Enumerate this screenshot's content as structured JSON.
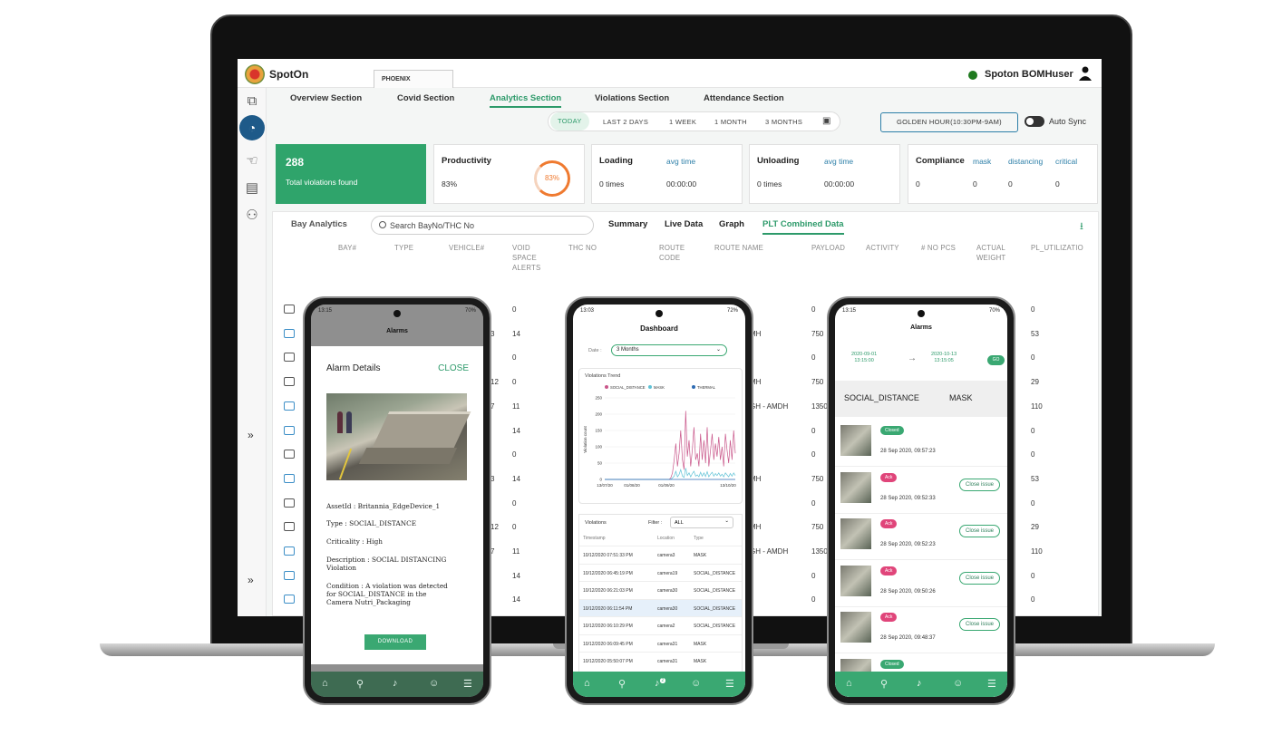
{
  "app": {
    "title": "SpotOn",
    "workspace_tab": "PHOENIX",
    "user": "Spoton BOMHuser",
    "status_color": "#1f7a1f",
    "accent": "#2d9a6a"
  },
  "rail": {
    "icons": [
      "hierarchy-icon",
      "dashboard-gauge-icon",
      "hand-icon",
      "building-icon",
      "group-icon"
    ],
    "expand_glyph": "»"
  },
  "sections": [
    "Overview Section",
    "Covid Section",
    "Analytics Section",
    "Violations Section",
    "Attendance Section"
  ],
  "active_section": "Analytics Section",
  "ranges": [
    "TODAY",
    "LAST 2 DAYS",
    "1 WEEK",
    "1 MONTH",
    "3 MONTHS"
  ],
  "active_range": "TODAY",
  "golden_hour": "GOLDEN HOUR(10:30PM-9AM)",
  "auto_sync": "Auto Sync",
  "kpi": {
    "violations": {
      "count": "288",
      "label": "Total violations found"
    },
    "productivity": {
      "title": "Productivity",
      "value": "83%",
      "ring": "83%"
    },
    "loading": {
      "title": "Loading",
      "avg_label": "avg time",
      "times": "0 times",
      "avg": "00:00:00"
    },
    "unloading": {
      "title": "Unloading",
      "avg_label": "avg time",
      "times": "0 times",
      "avg": "00:00:00"
    },
    "compliance": {
      "title": "Compliance",
      "labels": [
        "mask",
        "distancing",
        "critical"
      ],
      "values": [
        "0",
        "0",
        "0",
        "0"
      ]
    }
  },
  "bay": {
    "title": "Bay Analytics",
    "search_placeholder": "Search BayNo/THC No",
    "tabs": [
      "Summary",
      "Live Data",
      "Graph",
      "PLT Combined Data"
    ],
    "active_tab": "PLT Combined Data",
    "columns": [
      "BAY#",
      "TYPE",
      "VEHICLE#",
      "VOID SPACE ALERTS",
      "THC NO",
      "ROUTE CODE",
      "ROUTE NAME",
      "PAYLOAD",
      "ACTIVITY",
      "# NO PCS",
      "ACTUAL WEIGHT",
      "PL_UTILIZATIO"
    ],
    "rows": [
      {
        "void": "0",
        "route": "",
        "payload": "0",
        "util": "0",
        "icon": "dark",
        "frag": ""
      },
      {
        "void": "14",
        "route": "MH",
        "payload": "750",
        "util": "53",
        "icon": "blue",
        "frag": "3"
      },
      {
        "void": "0",
        "route": "",
        "payload": "0",
        "util": "0",
        "icon": "dark",
        "frag": ""
      },
      {
        "void": "0",
        "route": "MH",
        "payload": "750",
        "util": "29",
        "icon": "dark",
        "frag": "12"
      },
      {
        "void": "11",
        "route": "GH - AMDH",
        "payload": "1350",
        "util": "110",
        "icon": "blue",
        "frag": "7"
      },
      {
        "void": "14",
        "route": "",
        "payload": "0",
        "util": "0",
        "icon": "blue",
        "frag": ""
      },
      {
        "void": "0",
        "route": "",
        "payload": "0",
        "util": "0",
        "icon": "dark",
        "frag": ""
      },
      {
        "void": "14",
        "route": "MH",
        "payload": "750",
        "util": "53",
        "icon": "blue",
        "frag": "3"
      },
      {
        "void": "0",
        "route": "",
        "payload": "0",
        "util": "0",
        "icon": "dark",
        "frag": ""
      },
      {
        "void": "0",
        "route": "MH",
        "payload": "750",
        "util": "29",
        "icon": "dark",
        "frag": "12"
      },
      {
        "void": "11",
        "route": "GH - AMDH",
        "payload": "1350",
        "util": "110",
        "icon": "blue",
        "frag": "7"
      },
      {
        "void": "14",
        "route": "",
        "payload": "0",
        "util": "0",
        "icon": "blue",
        "frag": ""
      },
      {
        "void": "14",
        "route": "",
        "payload": "0",
        "util": "0",
        "icon": "blue",
        "frag": ""
      }
    ]
  },
  "phone1": {
    "status_time": "13:15",
    "status_right": "70%",
    "screen_title": "Alarms",
    "modal_title": "Alarm Details",
    "close": "CLOSE",
    "details": [
      "AssetId : Britannia_EdgeDevice_1",
      "Type : SOCIAL_DISTANCE",
      "Criticality : High",
      "Description : SOCIAL DISTANCING Violation",
      "Condition : A violation was detected for SOCIAL_DISTANCE in the Camera Nutri_Packaging"
    ],
    "download": "DOWNLOAD"
  },
  "phone2": {
    "status_time": "13:03",
    "status_right": "72%",
    "title": "Dashboard",
    "date_label": "Date :",
    "date_value": "3 Months",
    "chart_title": "Violations Trend",
    "list_title": "Violations",
    "filter_label": "Filter :",
    "filter_value": "ALL",
    "list_headers": [
      "Timestamp",
      "Location",
      "Type"
    ],
    "rows": [
      [
        "10/12/2020 07:51:33 PM",
        "camera3",
        "MASK"
      ],
      [
        "10/12/2020 06:45:19 PM",
        "camera19",
        "SOCIAL_DISTANCE"
      ],
      [
        "10/12/2020 06:21:03 PM",
        "camera30",
        "SOCIAL_DISTANCE"
      ],
      [
        "10/12/2020 06:11:54 PM",
        "camera30",
        "SOCIAL_DISTANCE"
      ],
      [
        "10/12/2020 06:10:29 PM",
        "camera2",
        "SOCIAL_DISTANCE"
      ],
      [
        "10/12/2020 06:09:45 PM",
        "camera31",
        "MASK"
      ],
      [
        "10/12/2020 05:50:07 PM",
        "camera31",
        "MASK"
      ]
    ],
    "highlight_row": 3,
    "nav_badge": "2"
  },
  "chart_data": {
    "type": "line",
    "title": "Violations Trend",
    "ylabel": "Violation count",
    "ylim": [
      0,
      250
    ],
    "yticks": [
      "250",
      "200",
      "150",
      "100",
      "50",
      "0"
    ],
    "xticks": [
      "13/07/20",
      "01/08/20",
      "01/09/20",
      "13/10/20"
    ],
    "legend_position": "top",
    "series": [
      {
        "name": "SOCIAL_DISTANCE",
        "color": "#c9568a",
        "values": [
          0,
          0,
          0,
          0,
          0,
          0,
          0,
          0,
          0,
          0,
          0,
          0,
          0,
          0,
          0,
          0,
          0,
          0,
          0,
          0,
          0,
          0,
          0,
          0,
          0,
          0,
          0,
          0,
          0,
          0,
          0,
          0,
          0,
          0,
          0,
          0,
          0,
          0,
          0,
          0,
          5,
          20,
          60,
          110,
          40,
          80,
          150,
          60,
          30,
          210,
          70,
          120,
          40,
          90,
          160,
          60,
          80,
          40,
          140,
          60,
          120,
          50,
          160,
          40,
          90,
          140,
          60,
          110,
          70,
          130,
          60,
          100,
          40,
          140,
          90,
          50,
          120,
          60,
          150,
          80
        ]
      },
      {
        "name": "MASK",
        "color": "#5fc2d6",
        "values": [
          0,
          0,
          0,
          0,
          0,
          0,
          0,
          0,
          0,
          0,
          0,
          0,
          0,
          0,
          0,
          0,
          0,
          0,
          0,
          0,
          0,
          0,
          0,
          0,
          0,
          0,
          0,
          0,
          0,
          0,
          0,
          0,
          0,
          0,
          0,
          0,
          0,
          0,
          0,
          0,
          0,
          5,
          10,
          25,
          8,
          15,
          30,
          10,
          6,
          35,
          12,
          20,
          8,
          18,
          25,
          10,
          14,
          8,
          22,
          10,
          20,
          9,
          24,
          8,
          16,
          22,
          10,
          18,
          12,
          20,
          10,
          16,
          8,
          20,
          14,
          8,
          18,
          10,
          20,
          12
        ]
      },
      {
        "name": "THERMAL",
        "color": "#2d6bb3",
        "values": [
          0,
          0,
          0,
          0,
          0,
          0,
          0,
          0,
          0,
          0,
          0,
          0,
          0,
          0,
          0,
          0,
          0,
          0,
          0,
          0,
          0,
          0,
          0,
          0,
          0,
          0,
          0,
          0,
          0,
          0,
          0,
          0,
          0,
          0,
          0,
          0,
          0,
          0,
          0,
          0,
          0,
          0,
          0,
          0,
          0,
          0,
          0,
          0,
          0,
          0,
          0,
          0,
          0,
          0,
          0,
          0,
          0,
          0,
          0,
          0,
          0,
          0,
          0,
          0,
          0,
          0,
          0,
          0,
          0,
          0,
          0,
          0,
          0,
          0,
          0,
          0,
          0,
          0,
          0,
          0
        ]
      }
    ]
  },
  "phone3": {
    "status_time": "13:15",
    "status_right": "70%",
    "title": "Alarms",
    "from": [
      "2020-09-01",
      "13:15:00"
    ],
    "to": [
      "2020-10-13",
      "13:15:05"
    ],
    "go": "GO",
    "tabs": [
      "SOCIAL_DISTANCE",
      "MASK"
    ],
    "items": [
      {
        "badge": "Closed",
        "kind": "closed",
        "time": "28 Sep 2020, 09:57:23",
        "button": ""
      },
      {
        "badge": "Ack",
        "kind": "ack",
        "time": "28 Sep 2020, 09:52:33",
        "button": "Close issue"
      },
      {
        "badge": "Ack",
        "kind": "ack",
        "time": "28 Sep 2020, 09:52:23",
        "button": "Close issue"
      },
      {
        "badge": "Ack",
        "kind": "ack",
        "time": "28 Sep 2020, 09:50:26",
        "button": "Close issue"
      },
      {
        "badge": "Ack",
        "kind": "ack",
        "time": "28 Sep 2020, 09:48:37",
        "button": "Close issue"
      },
      {
        "badge": "Closed",
        "kind": "closed",
        "time": "",
        "button": ""
      }
    ]
  }
}
